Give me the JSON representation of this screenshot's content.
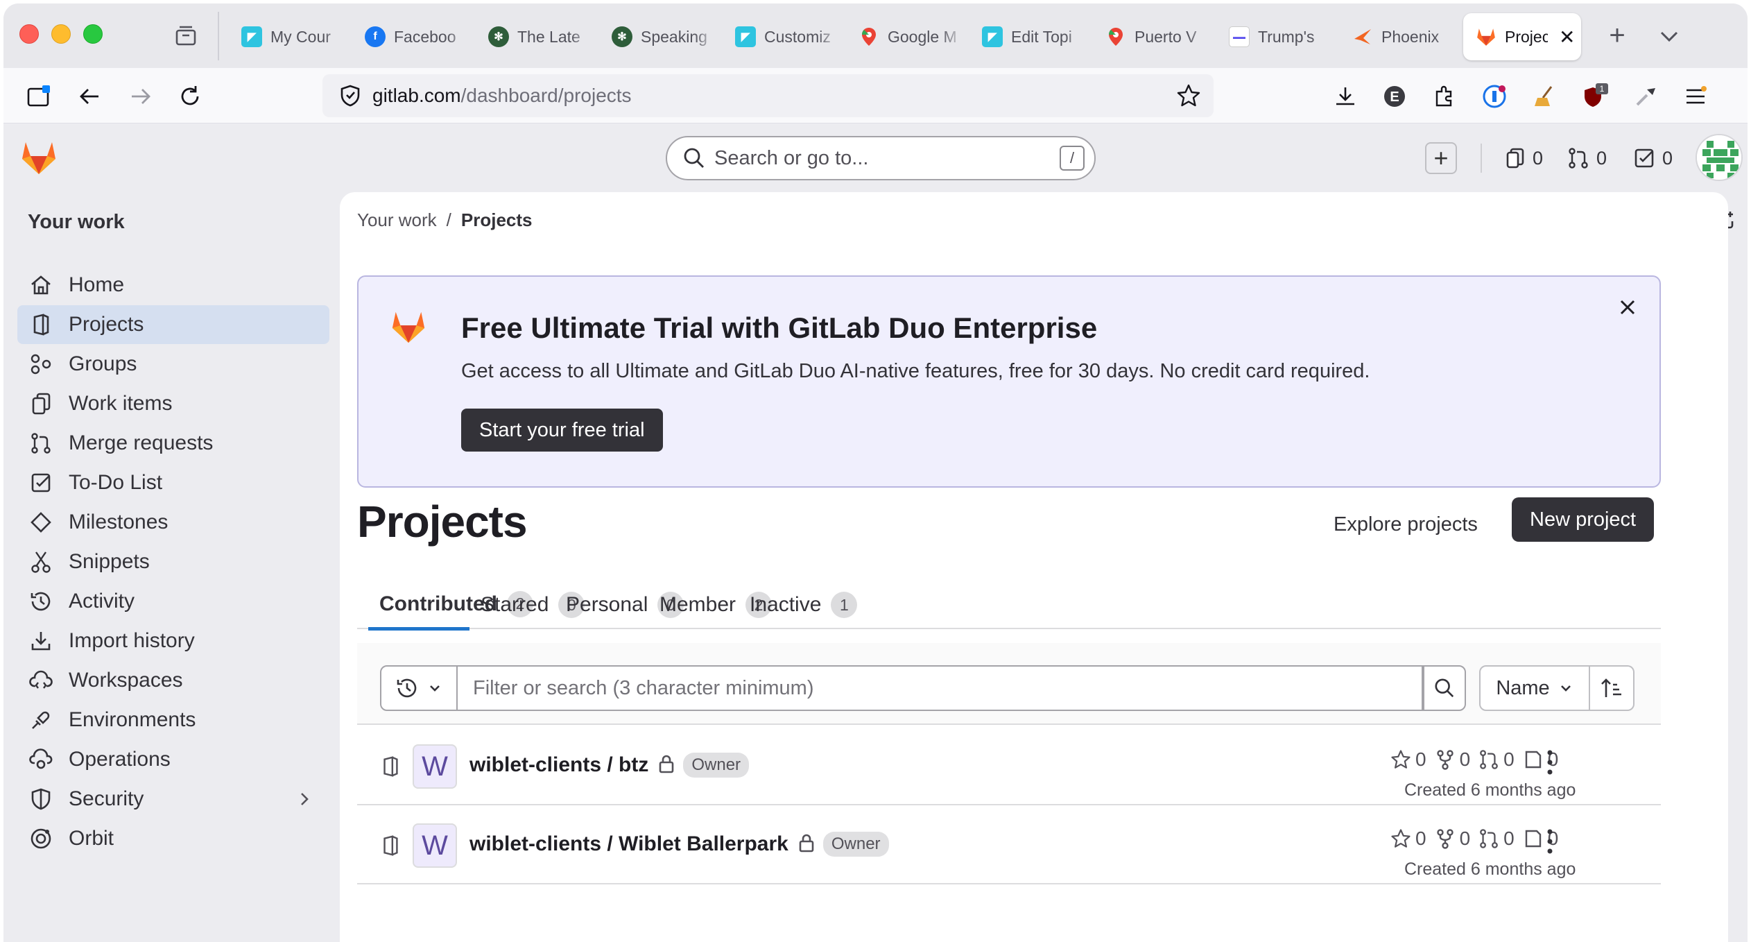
{
  "browser": {
    "tabs": [
      {
        "label": "My Cour",
        "icon": "wiblet-icon",
        "color": "#2ec4e0"
      },
      {
        "label": "Faceboo",
        "icon": "facebook-icon",
        "color": "#1877f2"
      },
      {
        "label": "The Late",
        "icon": "palm-icon",
        "color": "#2e5d3a"
      },
      {
        "label": "Speaking",
        "icon": "palm-icon",
        "color": "#2e5d3a"
      },
      {
        "label": "Customiz",
        "icon": "wiblet-icon",
        "color": "#2ec4e0"
      },
      {
        "label": "Google M",
        "icon": "maps-pin-icon",
        "color": "#34a853"
      },
      {
        "label": "Edit Topi",
        "icon": "wiblet-icon",
        "color": "#2ec4e0"
      },
      {
        "label": "Puerto V",
        "icon": "maps-pin-icon",
        "color": "#34a853"
      },
      {
        "label": "Trump's",
        "icon": "truth-social-icon",
        "color": "#5448ee"
      },
      {
        "label": "Phoenix",
        "icon": "phoenix-icon",
        "color": "#f26522"
      },
      {
        "label": "Projec",
        "icon": "gitlab-icon",
        "color": "#e24329",
        "active": true
      }
    ],
    "url_host": "gitlab.com",
    "url_path": "/dashboard/projects",
    "ext_badge": "1"
  },
  "header": {
    "search_placeholder": "Search or go to...",
    "search_shortcut": "/",
    "counts": {
      "issues": "0",
      "merge_requests": "0",
      "todos": "0"
    }
  },
  "sidebar": {
    "title": "Your work",
    "items": [
      {
        "label": "Home",
        "icon": "home-icon"
      },
      {
        "label": "Projects",
        "icon": "project-icon",
        "active": true
      },
      {
        "label": "Groups",
        "icon": "group-icon"
      },
      {
        "label": "Work items",
        "icon": "work-items-icon"
      },
      {
        "label": "Merge requests",
        "icon": "merge-request-icon"
      },
      {
        "label": "To-Do List",
        "icon": "todo-icon"
      },
      {
        "label": "Milestones",
        "icon": "milestone-icon"
      },
      {
        "label": "Snippets",
        "icon": "snippet-icon"
      },
      {
        "label": "Activity",
        "icon": "history-icon"
      },
      {
        "label": "Import history",
        "icon": "import-icon"
      },
      {
        "label": "Workspaces",
        "icon": "workspace-icon"
      },
      {
        "label": "Environments",
        "icon": "environment-icon"
      },
      {
        "label": "Operations",
        "icon": "operations-icon"
      },
      {
        "label": "Security",
        "icon": "shield-icon",
        "has_children": true
      },
      {
        "label": "Orbit",
        "icon": "orbit-icon"
      }
    ]
  },
  "breadcrumb": {
    "parent": "Your work",
    "separator": "/",
    "current": "Projects"
  },
  "banner": {
    "title": "Free Ultimate Trial with GitLab Duo Enterprise",
    "text": "Get access to all Ultimate and GitLab Duo AI-native features, free for 30 days. No credit card required.",
    "button": "Start your free trial"
  },
  "page": {
    "title": "Projects",
    "explore_label": "Explore projects",
    "new_project_label": "New project"
  },
  "tabs": [
    {
      "label": "Contributed",
      "count": "2",
      "active": true
    },
    {
      "label": "Starred",
      "count": "0"
    },
    {
      "label": "Personal",
      "count": "0"
    },
    {
      "label": "Member",
      "count": "2"
    },
    {
      "label": "Inactive",
      "count": "1"
    }
  ],
  "filter": {
    "placeholder": "Filter or search (3 character minimum)",
    "sort_label": "Name"
  },
  "projects": [
    {
      "avatar": "W",
      "name": "wiblet-clients / btz",
      "role": "Owner",
      "stars": "0",
      "forks": "0",
      "mrs": "0",
      "issues": "0",
      "created": "Created 6 months ago"
    },
    {
      "avatar": "W",
      "name": "wiblet-clients / Wiblet Ballerpark",
      "role": "Owner",
      "stars": "0",
      "forks": "0",
      "mrs": "0",
      "issues": "0",
      "created": "Created 6 months ago"
    }
  ],
  "colors": {
    "accent": "#1f75cb",
    "banner_bg": "#f0effd",
    "sidebar_active": "#d5dff0",
    "gitlab_orange": "#e24329"
  }
}
